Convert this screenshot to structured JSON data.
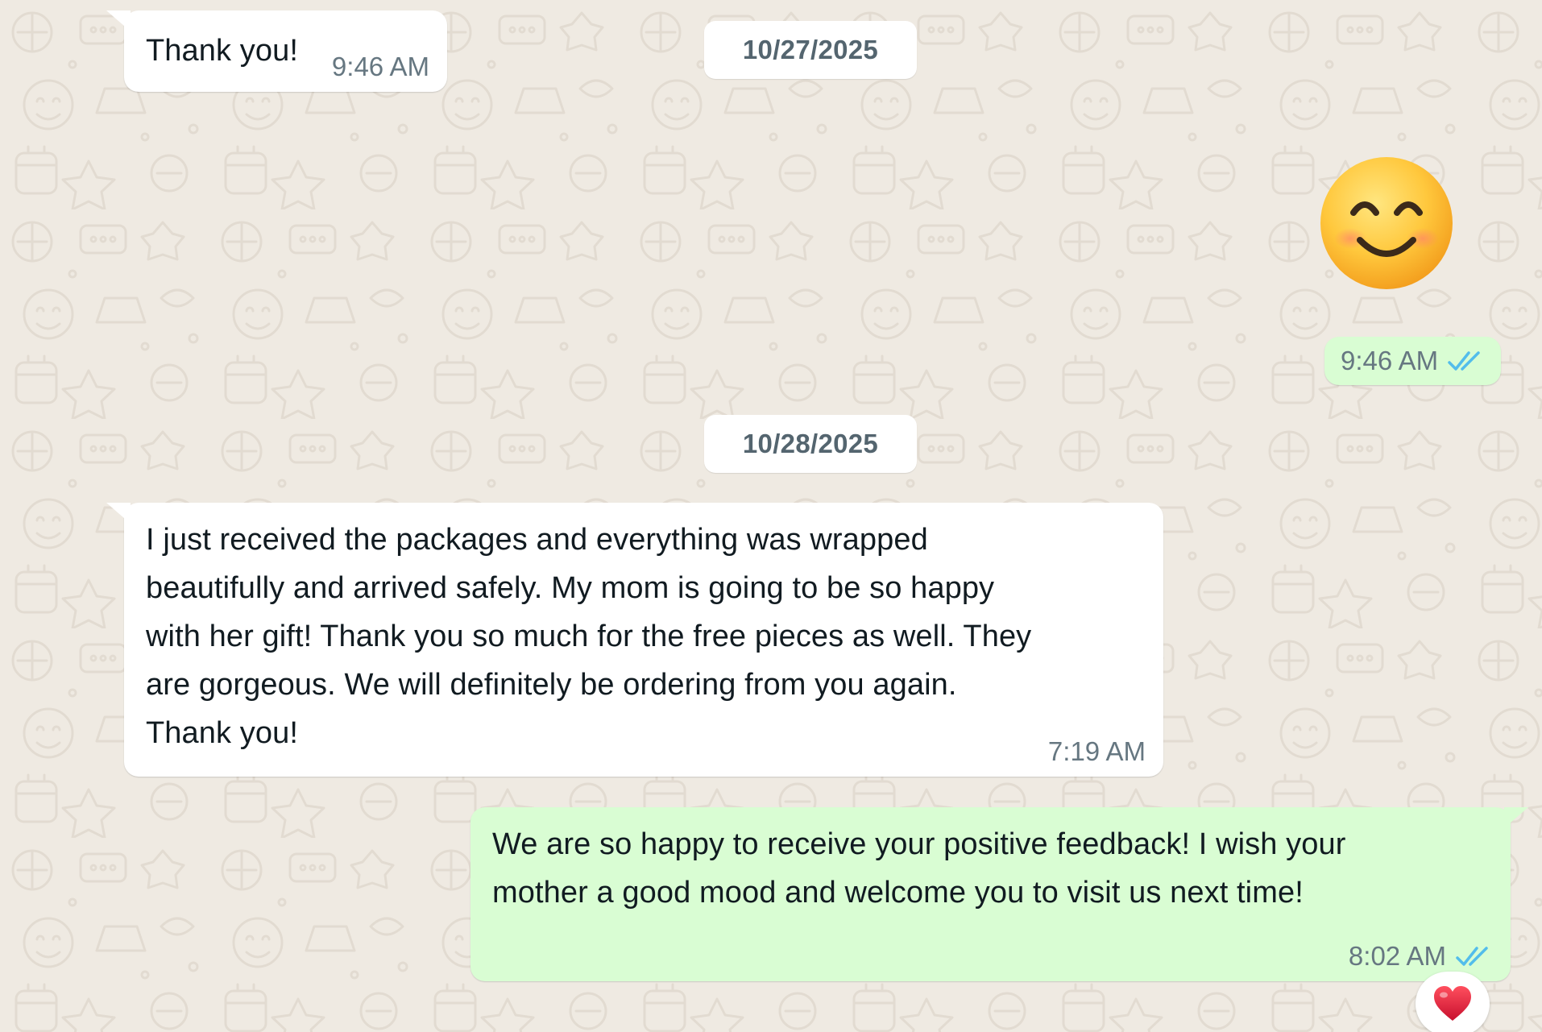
{
  "dates": [
    "10/27/2025",
    "10/28/2025"
  ],
  "messages": [
    {
      "direction": "incoming",
      "text": "Thank you!",
      "time": "9:46 AM"
    },
    {
      "direction": "outgoing",
      "type": "emoji",
      "emoji_name": "smiling-face-with-smiling-eyes",
      "time": "9:46 AM",
      "status": "read"
    },
    {
      "direction": "incoming",
      "lines": [
        "I just received the packages and everything was wrapped",
        "beautifully and arrived safely. My mom is going to be so happy",
        "with her gift! Thank you so much for the free pieces as well. They",
        "are gorgeous. We will definitely be ordering from you again.",
        "Thank you!"
      ],
      "time": "7:19 AM"
    },
    {
      "direction": "outgoing",
      "lines": [
        "We are so happy to receive your positive feedback! I wish your",
        "mother a good mood and welcome you to visit us next time!"
      ],
      "time": "8:02 AM",
      "status": "read",
      "reaction": "red-heart"
    }
  ],
  "colors": {
    "background": "#efeae2",
    "incoming_bubble": "#ffffff",
    "outgoing_bubble": "#d9fdd3",
    "timestamp": "#667781",
    "read_ticks": "#53bdeb",
    "heart": "#e0245e"
  }
}
